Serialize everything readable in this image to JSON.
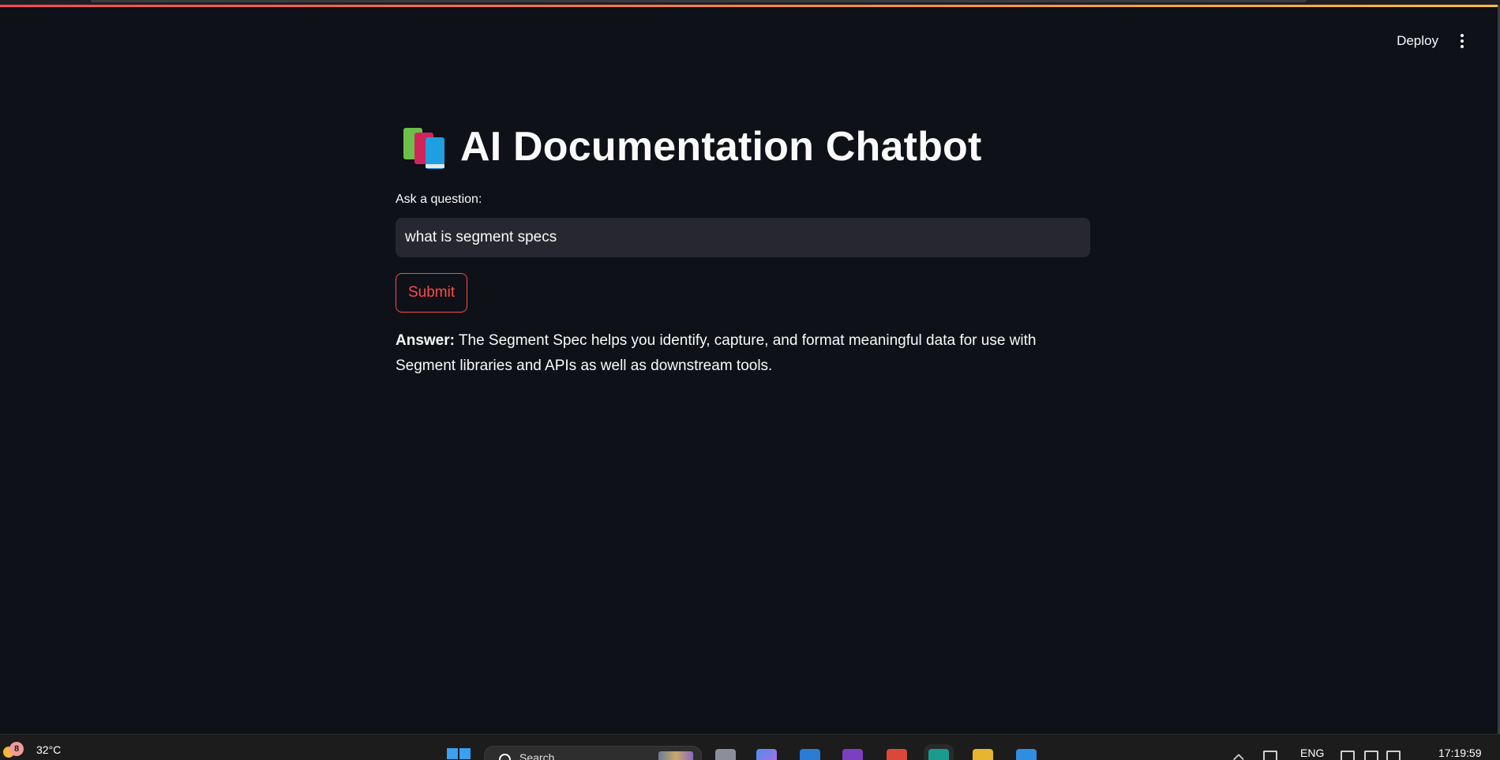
{
  "header": {
    "deploy_label": "Deploy"
  },
  "main": {
    "title": "AI Documentation Chatbot",
    "question_label": "Ask a question:",
    "question_value": "what is segment specs",
    "submit_label": "Submit",
    "answer_label": "Answer:",
    "answer_text": " The Segment Spec helps you identify, capture, and format meaningful data for use with Segment libraries and APIs as well as downstream tools."
  },
  "taskbar": {
    "weather_badge": "8",
    "weather_temp": "32°C",
    "search_placeholder": "Search",
    "language": "ENG",
    "clock": "17:19:59"
  },
  "colors": {
    "background": "#0e1117",
    "accent": "#ff4b4b",
    "input_bg": "#262730",
    "text": "#fafafa"
  }
}
